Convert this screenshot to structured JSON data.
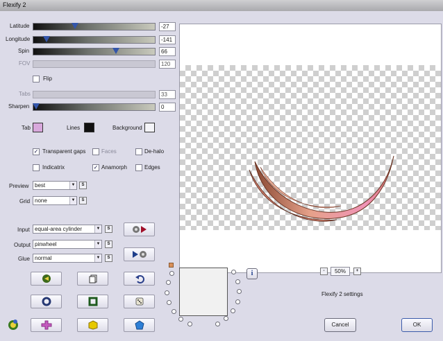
{
  "window": {
    "title": "Flexify 2"
  },
  "params": {
    "latitude": {
      "label": "Latitude",
      "value": "-27",
      "fraction": 0.34
    },
    "longitude": {
      "label": "Longitude",
      "value": "-141",
      "fraction": 0.11
    },
    "spin": {
      "label": "Spin",
      "value": "66",
      "fraction": 0.68
    },
    "fov": {
      "label": "FOV",
      "value": "120"
    },
    "flip": {
      "label": "Flip"
    },
    "tabs": {
      "label": "Tabs",
      "value": "33"
    },
    "sharpen": {
      "label": "Sharpen",
      "value": "0",
      "fraction": 0.02
    }
  },
  "colors": {
    "tab_label": "Tab",
    "tab_color": "#d8a8dc",
    "lines_label": "Lines",
    "lines_color": "#111111",
    "background_label": "Background",
    "background_color": "#f4f4f8"
  },
  "options": {
    "transparent_gaps": {
      "label": "Transparent gaps",
      "checked": true
    },
    "faces": {
      "label": "Faces",
      "checked": false
    },
    "de_halo": {
      "label": "De-halo",
      "checked": false
    },
    "indicatrix": {
      "label": "Indicatrix",
      "checked": false
    },
    "anamorph": {
      "label": "Anamorph",
      "checked": true
    },
    "edges": {
      "label": "Edges",
      "checked": false
    }
  },
  "preview_quality": {
    "label": "Preview",
    "value": "best"
  },
  "grid": {
    "label": "Grid",
    "value": "none"
  },
  "projection": {
    "input_label": "Input",
    "input_value": "equal-area cylinder",
    "output_label": "Output",
    "output_value": "pinwheel",
    "glue_label": "Glue",
    "glue_value": "normal"
  },
  "s_label": "S",
  "zoom": {
    "minus": "-",
    "value": "50%",
    "plus": "+"
  },
  "info_label": "i",
  "settings_text": "Flexify 2 settings",
  "buttons": {
    "cancel": "Cancel",
    "ok": "OK"
  },
  "icons": {
    "swap": "swap-arrows-icon",
    "reset": "reset-icon",
    "copy": "copy-icon",
    "undo": "undo-icon",
    "ring": "ring-icon",
    "square": "square-icon",
    "dice": "dice-icon",
    "plus": "plus-shape-icon",
    "cube": "cube-icon",
    "pentagon": "pentagon-icon",
    "logo": "flexify-logo-icon"
  }
}
